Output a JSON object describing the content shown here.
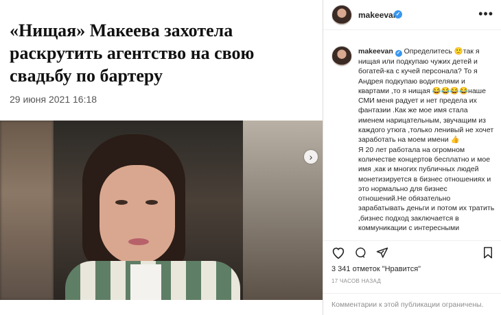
{
  "article": {
    "headline": "«Нищая» Макеева захотела раскрутить агентство на свою свадьбу по бартеру",
    "date": "29 июня 2021 16:18"
  },
  "instagram": {
    "username": "makeevan",
    "caption_paragraphs": [
      "Определитесь 🙂так я нищая или подкупаю чужих детей и богатей-ка с кучей персонала? То я Андрея подкупаю водителями и квартами ,то я нищая 😂😂😂😂наше СМИ меня радует и нет предела их фантазии .Как же мое имя стала именем нарицательным, звучащим из каждого утюга ,только ленивый не хочет заработать на моем имени 👍",
      "Я 20 лет работала на огромном количестве концертов бесплатно и мое имя ,как и многих публичных людей монетизируется в бизнес отношениях и это нормально для бизнес отношений.Не обязательно зарабатывать деньги и потом их тратить ,бизнес подход заключается в коммуникации с интересными"
    ],
    "likes": "3 341 отметок \"Нравится\"",
    "time_ago": "17 ЧАСОВ НАЗАД",
    "comments_notice": "Комментарии к этой публикации ограничены.",
    "icons": {
      "like": "heart-icon",
      "comment": "comment-icon",
      "share": "share-icon",
      "save": "bookmark-icon",
      "more": "more-icon",
      "verified": "verified-badge-icon",
      "next": "chevron-right-icon"
    },
    "accent_color": "#3897f0"
  }
}
